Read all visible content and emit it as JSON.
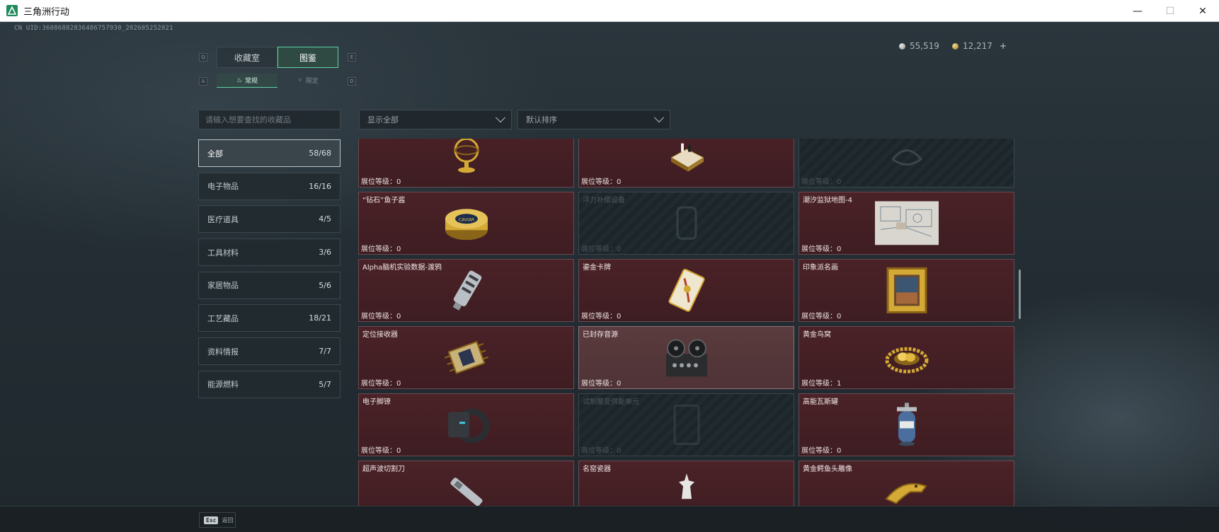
{
  "window": {
    "title": "三角洲行动",
    "minimize": "—",
    "maximize": "☐",
    "close": "✕",
    "icon": "delta-logo-icon"
  },
  "uid": "CN UID:360868828364867579​30_202605252021",
  "currency": {
    "silver": "55,519",
    "gold": "12,217",
    "plus": "+"
  },
  "tabs": {
    "key_left": "Q",
    "key_right": "E",
    "items": [
      "收藏室",
      "图鉴"
    ],
    "active": 1
  },
  "subtabs": {
    "key_left": "A",
    "key_right": "D",
    "items": [
      "常规",
      "限定"
    ]
  },
  "search": {
    "placeholder": "请输入想要查找的收藏品"
  },
  "categories": [
    {
      "label": "全部",
      "count": "58/68"
    },
    {
      "label": "电子物品",
      "count": "16/16"
    },
    {
      "label": "医疗道具",
      "count": "4/5"
    },
    {
      "label": "工具材料",
      "count": "3/6"
    },
    {
      "label": "家居物品",
      "count": "5/6"
    },
    {
      "label": "工艺藏品",
      "count": "18/21"
    },
    {
      "label": "资料情报",
      "count": "7/7"
    },
    {
      "label": "能源燃料",
      "count": "5/7"
    }
  ],
  "filters": {
    "display": "显示全部",
    "sort": "默认排序"
  },
  "level_label": "展位等级：",
  "cards": [
    {
      "name": "",
      "level": "0",
      "locked": false,
      "icon": "gold-globe-icon"
    },
    {
      "name": "",
      "level": "0",
      "locked": false,
      "icon": "chess-set-icon"
    },
    {
      "name": "",
      "level": "0",
      "locked": true,
      "icon": "unknown-item-icon"
    },
    {
      "name": "“钻石”鱼子酱",
      "level": "0",
      "locked": false,
      "icon": "caviar-tin-icon"
    },
    {
      "name": "浮力补偿设备",
      "level": "0",
      "locked": true,
      "icon": "buoyancy-device-icon"
    },
    {
      "name": "潮汐监狱地图-4",
      "level": "0",
      "locked": false,
      "icon": "map-icon"
    },
    {
      "name": "Alpha脑机实验数据-渡鸦",
      "level": "0",
      "locked": false,
      "icon": "data-device-icon"
    },
    {
      "name": "鎏金卡牌",
      "level": "0",
      "locked": false,
      "icon": "gilded-card-icon"
    },
    {
      "name": "印象派名画",
      "level": "0",
      "locked": false,
      "icon": "framed-painting-icon"
    },
    {
      "name": "定位接收器",
      "level": "0",
      "locked": false,
      "icon": "receiver-icon"
    },
    {
      "name": "已封存音源",
      "level": "0",
      "locked": false,
      "icon": "tape-recorder-icon",
      "hover": true
    },
    {
      "name": "黄金鸟窝",
      "level": "1",
      "locked": false,
      "icon": "golden-nest-icon"
    },
    {
      "name": "电子脚镣",
      "level": "0",
      "locked": false,
      "icon": "ankle-monitor-icon"
    },
    {
      "name": "试制聚变供能单元",
      "level": "0",
      "locked": true,
      "icon": "fusion-unit-icon"
    },
    {
      "name": "高能瓦斯罐",
      "level": "0",
      "locked": false,
      "icon": "gas-canister-icon"
    },
    {
      "name": "超声波切割刀",
      "level": "",
      "locked": false,
      "icon": "cutter-icon"
    },
    {
      "name": "名窑瓷器",
      "level": "",
      "locked": false,
      "icon": "porcelain-icon"
    },
    {
      "name": "黄金鳄鱼头雕像",
      "level": "",
      "locked": false,
      "icon": "gold-croc-icon"
    }
  ],
  "bottom": {
    "esc_key": "Esc",
    "esc_label": "返回"
  },
  "colors": {
    "accent": "#5fd3a3",
    "card_bg": "#4a2227",
    "locked_bg": "#1c2529"
  }
}
